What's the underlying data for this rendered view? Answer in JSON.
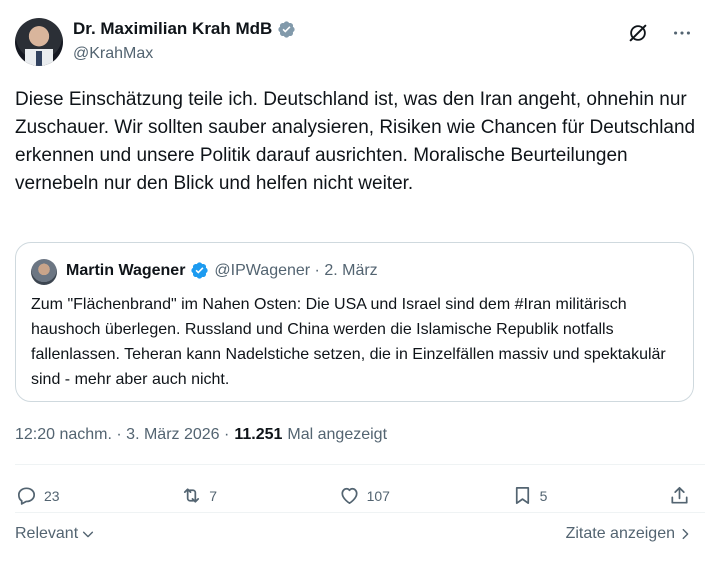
{
  "author": {
    "name": "Dr. Maximilian Krah MdB",
    "handle": "@KrahMax",
    "verified_color": "#829aab"
  },
  "tweet": {
    "text": "Diese Einschätzung teile ich. Deutschland ist, was den Iran angeht, ohnehin nur Zuschauer. Wir sollten sauber analysieren, Risiken wie Chancen für Deutschland erkennen und unsere Politik darauf ausrichten. Moralische Beurteilungen vernebeln nur den Blick und helfen nicht weiter."
  },
  "quote": {
    "name": "Martin Wagener",
    "meta": "@IPWagener · 2. März",
    "verified_color": "#1d9bf0",
    "text": "Zum \"Flächenbrand\" im Nahen Osten: Die USA und Israel sind dem #Iran militärisch haushoch überlegen. Russland und China werden die Islamische Republik notfalls fallenlassen. Teheran kann Nadelstiche setzen, die in Einzelfällen massiv und spektakulär sind - mehr aber auch nicht."
  },
  "timestamp": {
    "time": "12:20 nachm. · 3. März 2026 ·",
    "views": "11.251",
    "views_label": "Mal angezeigt"
  },
  "actions": {
    "replies": "23",
    "reposts": "7",
    "likes": "107",
    "bookmarks": "5"
  },
  "footer": {
    "sort_label": "Relevant",
    "quotes_label": "Zitate anzeigen"
  },
  "icons": {
    "grok": "grok-icon",
    "more": "more-icon",
    "reply": "reply-icon",
    "repost": "repost-icon",
    "like": "heart-icon",
    "bookmark": "bookmark-icon",
    "share": "share-icon"
  }
}
